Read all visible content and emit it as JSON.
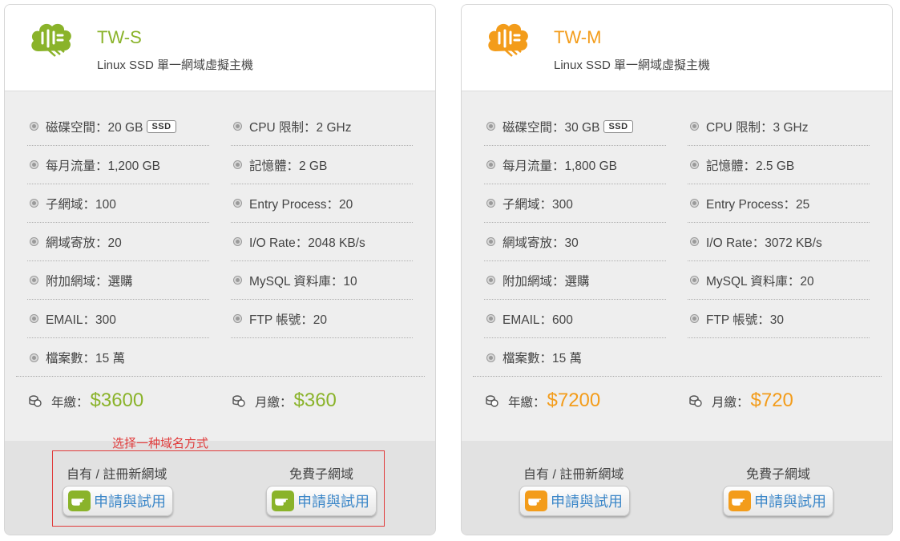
{
  "colors": {
    "s_accent": "#8ab32a",
    "m_accent": "#f39c1a",
    "annotation": "#e03b3b",
    "link": "#3a86c8"
  },
  "annotation": {
    "text": "选择一种域名方式"
  },
  "plans": {
    "s": {
      "name": "TW-S",
      "desc": "Linux SSD 單一網域虛擬主機",
      "left_specs": [
        "磁碟空間：20 GB",
        "每月流量：1,200 GB",
        "子網域：100",
        "網域寄放：20",
        "附加網域：選購",
        "EMAIL：300",
        "檔案數：15 萬"
      ],
      "right_specs": [
        "CPU 限制：2 GHz",
        "記憶體：2 GB",
        "Entry Process：20",
        "I/O Rate：2048 KB/s",
        "MySQL 資料庫：10",
        "FTP 帳號：20"
      ],
      "ssd_badge": "SSD",
      "year_label": "年繳：",
      "year_price": "$3600",
      "month_label": "月繳：",
      "month_price": "$360",
      "option1": "自有 / 註冊新網域",
      "option2": "免費子網域",
      "button": "申請與試用"
    },
    "m": {
      "name": "TW-M",
      "desc": "Linux SSD 單一網域虛擬主機",
      "left_specs": [
        "磁碟空間：30 GB",
        "每月流量：1,800 GB",
        "子網域：300",
        "網域寄放：30",
        "附加網域：選購",
        "EMAIL：600",
        "檔案數：15 萬"
      ],
      "right_specs": [
        "CPU 限制：3 GHz",
        "記憶體：2.5 GB",
        "Entry Process：25",
        "I/O Rate：3072 KB/s",
        "MySQL 資料庫：20",
        "FTP 帳號：30"
      ],
      "ssd_badge": "SSD",
      "year_label": "年繳：",
      "year_price": "$7200",
      "month_label": "月繳：",
      "month_price": "$720",
      "option1": "自有 / 註冊新網域",
      "option2": "免費子網域",
      "button": "申請與試用"
    }
  }
}
